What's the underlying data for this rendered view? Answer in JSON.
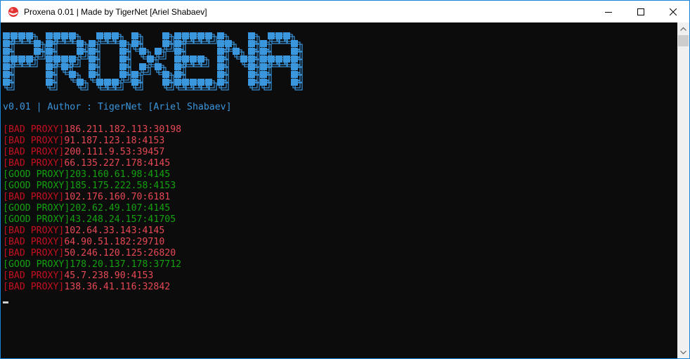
{
  "window": {
    "title": "Proxena 0.01 | Made by TigerNet [Ariel Shabaev]",
    "icon": "red-ball-icon",
    "controls": [
      "minimize-icon",
      "maximize-icon",
      "close-icon"
    ]
  },
  "console": {
    "logo_text": "PROXENA",
    "author_line": "v0.01 | Author : TigerNet [Ariel Shabaev]",
    "log": [
      {
        "tag": "[BAD PROXY]",
        "proxy": "186.211.182.113:30198",
        "status": "bad"
      },
      {
        "tag": "[BAD PROXY]",
        "proxy": "91.187.123.18:4153",
        "status": "bad"
      },
      {
        "tag": "[BAD PROXY]",
        "proxy": "200.111.9.53:39457",
        "status": "bad"
      },
      {
        "tag": "[BAD PROXY]",
        "proxy": "66.135.227.178:4145",
        "status": "bad"
      },
      {
        "tag": "[GOOD PROXY]",
        "proxy": "203.160.61.98:4145",
        "status": "good"
      },
      {
        "tag": "[GOOD PROXY]",
        "proxy": "185.175.222.58:4153",
        "status": "good"
      },
      {
        "tag": "[BAD PROXY]",
        "proxy": "102.176.160.70:6181",
        "status": "bad"
      },
      {
        "tag": "[GOOD PROXY]",
        "proxy": "202.62.49.107:4145",
        "status": "good"
      },
      {
        "tag": "[GOOD PROXY]",
        "proxy": "43.248.24.157:41705",
        "status": "good"
      },
      {
        "tag": "[BAD PROXY]",
        "proxy": "102.64.33.143:4145",
        "status": "bad"
      },
      {
        "tag": "[BAD PROXY]",
        "proxy": "64.90.51.182:29710",
        "status": "bad"
      },
      {
        "tag": "[BAD PROXY]",
        "proxy": "50.246.120.125:26820",
        "status": "bad"
      },
      {
        "tag": "[GOOD PROXY]",
        "proxy": "178.20.137.178:37712",
        "status": "good"
      },
      {
        "tag": "[BAD PROXY]",
        "proxy": "45.7.238.90:4153",
        "status": "bad"
      },
      {
        "tag": "[BAD PROXY]",
        "proxy": "138.36.41.116:32842",
        "status": "bad"
      }
    ]
  },
  "colors": {
    "logo_fill": "#3a96dd",
    "author_text": "#3a96dd",
    "bad_proxy": "#e74856",
    "good_proxy": "#13a10e",
    "console_bg": "#0c0c0c"
  }
}
